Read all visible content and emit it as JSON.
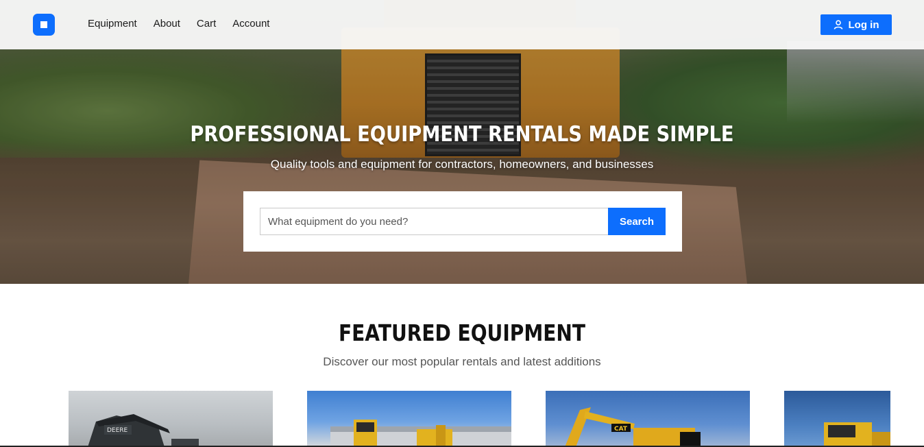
{
  "nav": {
    "links": [
      "Equipment",
      "About",
      "Cart",
      "Account"
    ],
    "login_label": "Log in"
  },
  "hero": {
    "title": "PROFESSIONAL EQUIPMENT RENTALS MADE SIMPLE",
    "subtitle": "Quality tools and equipment for contractors, homeowners, and businesses"
  },
  "search": {
    "placeholder": "What equipment do you need?",
    "button_label": "Search"
  },
  "featured": {
    "title": "FEATURED EQUIPMENT",
    "subtitle": "Discover our most popular rentals and latest additions",
    "cards": [
      {
        "brand_text": "DEERE"
      },
      {
        "brand_text": ""
      },
      {
        "brand_text": "CAT"
      },
      {
        "brand_text": ""
      }
    ]
  },
  "colors": {
    "accent": "#0d6efd",
    "nav_bg": "#f8f8f8",
    "text_dark": "#111111",
    "text_muted": "#555555"
  }
}
